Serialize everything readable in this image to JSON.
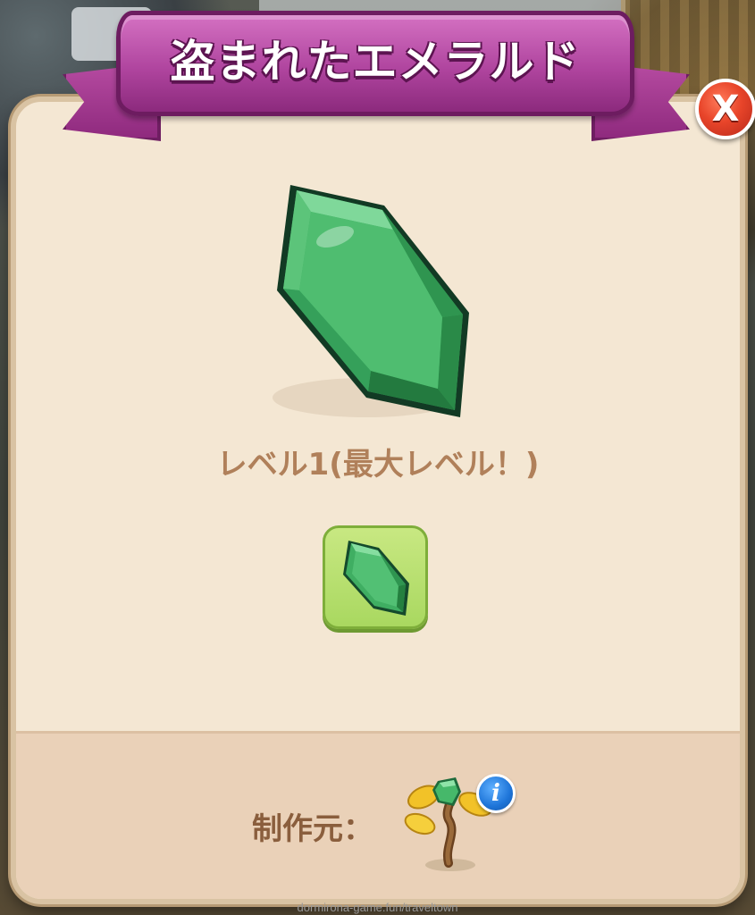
{
  "dialog": {
    "title": "盗まれたエメラルド",
    "close_label": "X",
    "level_text": "レベル1(最大レベル！)",
    "item_icon": "emerald-icon",
    "footer": {
      "maker_label": "制作元：",
      "maker_icon": "sprout-plant-icon",
      "info_label": "i"
    }
  },
  "watermark": "dormirona-game.fun/traveltown",
  "colors": {
    "ribbon": "#b0459f",
    "panel": "#f4e7d3",
    "footer": "#ead1b8",
    "level_text": "#b0805a",
    "close_button": "#e8452a",
    "tile": "#a9d860",
    "info_badge": "#1d74d8"
  }
}
